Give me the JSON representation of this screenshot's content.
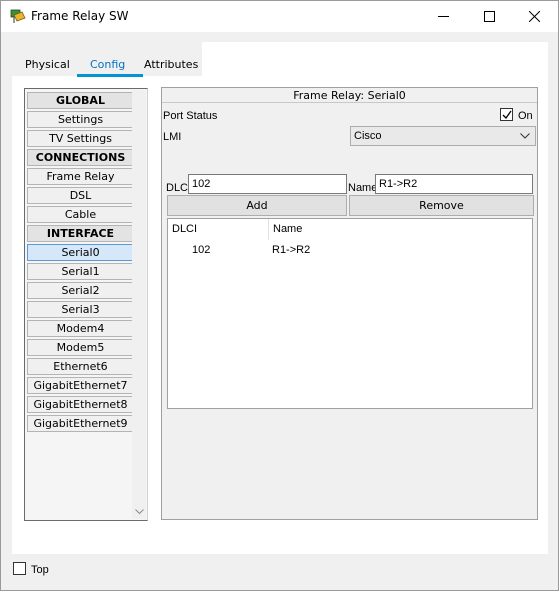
{
  "window": {
    "title": "Frame Relay SW"
  },
  "tabs": [
    {
      "label": "Physical"
    },
    {
      "label": "Config"
    },
    {
      "label": "Attributes"
    }
  ],
  "nav": {
    "items": [
      {
        "label": "GLOBAL",
        "type": "header"
      },
      {
        "label": "Settings",
        "type": "item"
      },
      {
        "label": "TV Settings",
        "type": "item"
      },
      {
        "label": "CONNECTIONS",
        "type": "header"
      },
      {
        "label": "Frame Relay",
        "type": "item"
      },
      {
        "label": "DSL",
        "type": "item"
      },
      {
        "label": "Cable",
        "type": "item"
      },
      {
        "label": "INTERFACE",
        "type": "header"
      },
      {
        "label": "Serial0",
        "type": "selected"
      },
      {
        "label": "Serial1",
        "type": "item"
      },
      {
        "label": "Serial2",
        "type": "item"
      },
      {
        "label": "Serial3",
        "type": "item"
      },
      {
        "label": "Modem4",
        "type": "item"
      },
      {
        "label": "Modem5",
        "type": "item"
      },
      {
        "label": "Ethernet6",
        "type": "item"
      },
      {
        "label": "GigabitEthernet7",
        "type": "item"
      },
      {
        "label": "GigabitEthernet8",
        "type": "item"
      },
      {
        "label": "GigabitEthernet9",
        "type": "item"
      }
    ]
  },
  "content": {
    "title": "Frame Relay: Serial0",
    "port_status_label": "Port Status",
    "on_label": "On",
    "on_checked": true,
    "lmi_label": "LMI",
    "lmi_value": "Cisco",
    "dlci_label": "DLCI",
    "dlci_value": "102",
    "name_label": "Name",
    "name_value": "R1->R2",
    "add_label": "Add",
    "remove_label": "Remove",
    "table": {
      "headers": [
        "DLCI",
        "Name"
      ],
      "rows": [
        {
          "dlci": "102",
          "name": "R1->R2"
        }
      ]
    }
  },
  "footer": {
    "top_label": "Top",
    "top_checked": false
  },
  "colors": {
    "accent": "#0096d6",
    "selected_bg": "#d5e7f8"
  }
}
